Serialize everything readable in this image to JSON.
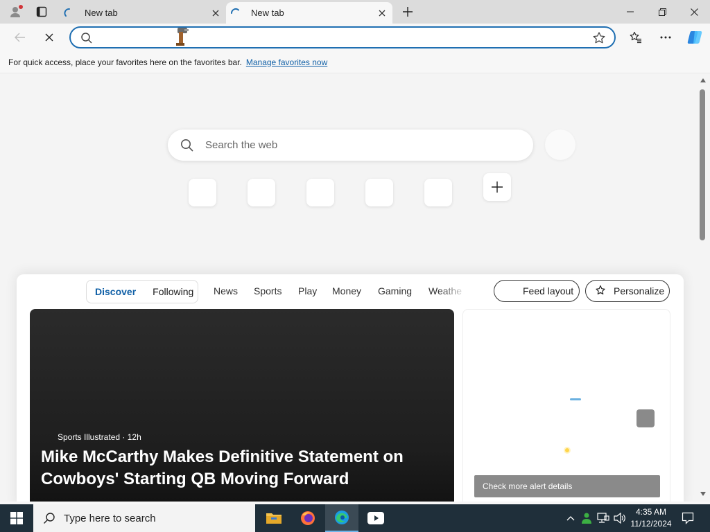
{
  "browser": {
    "tabs": [
      {
        "title": "New tab",
        "icon": "loading-spinner"
      },
      {
        "title": "New tab",
        "icon": "loading-spinner"
      }
    ],
    "new_tab_icon": "plus-icon",
    "address_bar": {
      "value": "",
      "placeholder": ""
    }
  },
  "favorites_bar": {
    "message": "For quick access, place your favorites here on the favorites bar.",
    "link": "Manage favorites now"
  },
  "newtab": {
    "search_placeholder": "Search the web",
    "quick_links_count_visible": 5
  },
  "feed": {
    "pills": [
      "Discover",
      "Following"
    ],
    "active_pill": "Discover",
    "nav": [
      "News",
      "Sports",
      "Play",
      "Money",
      "Gaming",
      "Weathe"
    ],
    "feed_layout_label": "Feed layout",
    "personalize_label": "Personalize",
    "hero": {
      "source": "Sports Illustrated",
      "age": "· 12h",
      "headline": "Mike McCarthy Makes Definitive Statement on Cowboys' Starting QB Moving Forward"
    },
    "side_card": {
      "button": "Check more alert details"
    }
  },
  "taskbar": {
    "search_placeholder": "Type here to search",
    "time": "4:35 AM",
    "date": "11/12/2024"
  },
  "colors": {
    "accent": "#1f6fb2",
    "link": "#0f5fa6",
    "taskbar": "#1f2f3a"
  }
}
